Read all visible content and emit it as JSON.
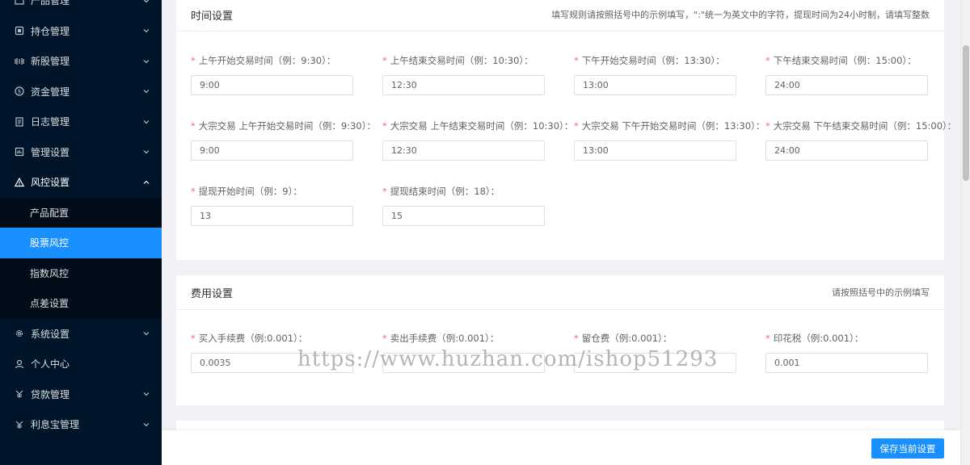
{
  "sidebar": {
    "items": [
      {
        "label": "产品管理",
        "icon": "product-icon"
      },
      {
        "label": "持仓管理",
        "icon": "position-icon"
      },
      {
        "label": "新股管理",
        "icon": "ipo-icon"
      },
      {
        "label": "资金管理",
        "icon": "money-icon"
      },
      {
        "label": "日志管理",
        "icon": "log-icon"
      },
      {
        "label": "管理设置",
        "icon": "admin-icon"
      },
      {
        "label": "风控设置",
        "icon": "warning-icon"
      },
      {
        "label": "系统设置",
        "icon": "gear-icon"
      },
      {
        "label": "个人中心",
        "icon": "user-icon"
      },
      {
        "label": "贷款管理",
        "icon": "loan-icon"
      },
      {
        "label": "利息宝管理",
        "icon": "interest-icon"
      }
    ],
    "risk_submenu": [
      {
        "label": "产品配置"
      },
      {
        "label": "股票风控"
      },
      {
        "label": "指数风控"
      },
      {
        "label": "点差设置"
      }
    ],
    "active_submenu": "股票风控"
  },
  "time_settings": {
    "title": "时间设置",
    "hint": "填写规则请按照括号中的示例填写，\":\"统一为英文中的字符，提现时间为24小时制，请填写整数",
    "fields": [
      {
        "label": "上午开始交易时间（例：9:30）：",
        "value": "9:00"
      },
      {
        "label": "上午结束交易时间（例：10:30）：",
        "value": "12:30"
      },
      {
        "label": "下午开始交易时间（例：13:30）：",
        "value": "13:00"
      },
      {
        "label": "下午结束交易时间（例：15:00）：",
        "value": "24:00"
      },
      {
        "label": "大宗交易 上午开始交易时间（例：9:30）：",
        "value": "9:00"
      },
      {
        "label": "大宗交易 上午结束交易时间（例：10:30）：",
        "value": "12:30"
      },
      {
        "label": "大宗交易 下午开始交易时间（例：13:30）：",
        "value": "13:00"
      },
      {
        "label": "大宗交易 下午结束交易时间（例：15:00）：",
        "value": "24:00"
      },
      {
        "label": "提现开始时间（例：9）：",
        "value": "13"
      },
      {
        "label": "提现结束时间（例：18）：",
        "value": "15"
      }
    ]
  },
  "fee_settings": {
    "title": "费用设置",
    "hint": "请按照括号中的示例填写",
    "fields": [
      {
        "label": "买入手续费（例:0.001）：",
        "value": "0.0035"
      },
      {
        "label": "卖出手续费（例:0.001）：",
        "value": ""
      },
      {
        "label": "留仓费（例:0.001）：",
        "value": ""
      },
      {
        "label": "印花税（例:0.001）：",
        "value": "0.001"
      }
    ]
  },
  "footer": {
    "save_label": "保存当前设置"
  },
  "watermark": "https://www.huzhan.com/ishop51293"
}
